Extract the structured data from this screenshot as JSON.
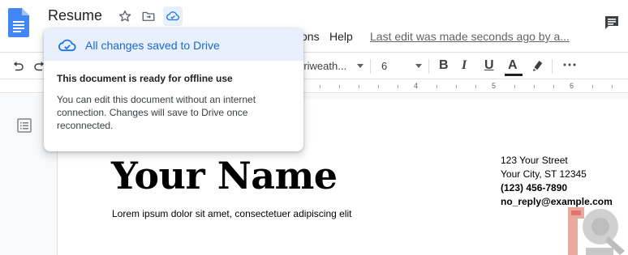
{
  "document": {
    "title": "Resume"
  },
  "menu": {
    "items": [
      "ons",
      "Help"
    ],
    "last_edit": "Last edit was made seconds ago by a..."
  },
  "toolbar": {
    "font": "rriweath...",
    "font_size": "6",
    "bold": "B",
    "italic": "I",
    "underline": "U",
    "text_color": "A",
    "more": "⋯",
    "text_color_underline": "#202124"
  },
  "ruler": {
    "numbers": [
      "4",
      "5",
      "6"
    ]
  },
  "page": {
    "name": "Your Name",
    "lorem": "Lorem ipsum dolor sit amet, consectetuer adipiscing elit",
    "address": [
      "123 Your Street",
      "Your City, ST 12345"
    ],
    "phone": "(123) 456-7890",
    "email": "no_reply@example.com"
  },
  "popup": {
    "saved": "All changes saved to Drive",
    "offline_title": "This document is ready for offline use",
    "offline_body": "You can edit this document without an internet connection. Changes will save to Drive once reconnected."
  },
  "colors": {
    "accent": "#1a73e8",
    "saved_text": "#1967d2",
    "popup_header": "#e8f0fe",
    "docs_blue": "#4285f4"
  },
  "icons": [
    "docs-logo-icon",
    "star-icon",
    "move-folder-icon",
    "cloud-saved-icon",
    "comment-icon",
    "undo-icon",
    "redo-icon",
    "highlighter-icon",
    "outline-icon"
  ]
}
